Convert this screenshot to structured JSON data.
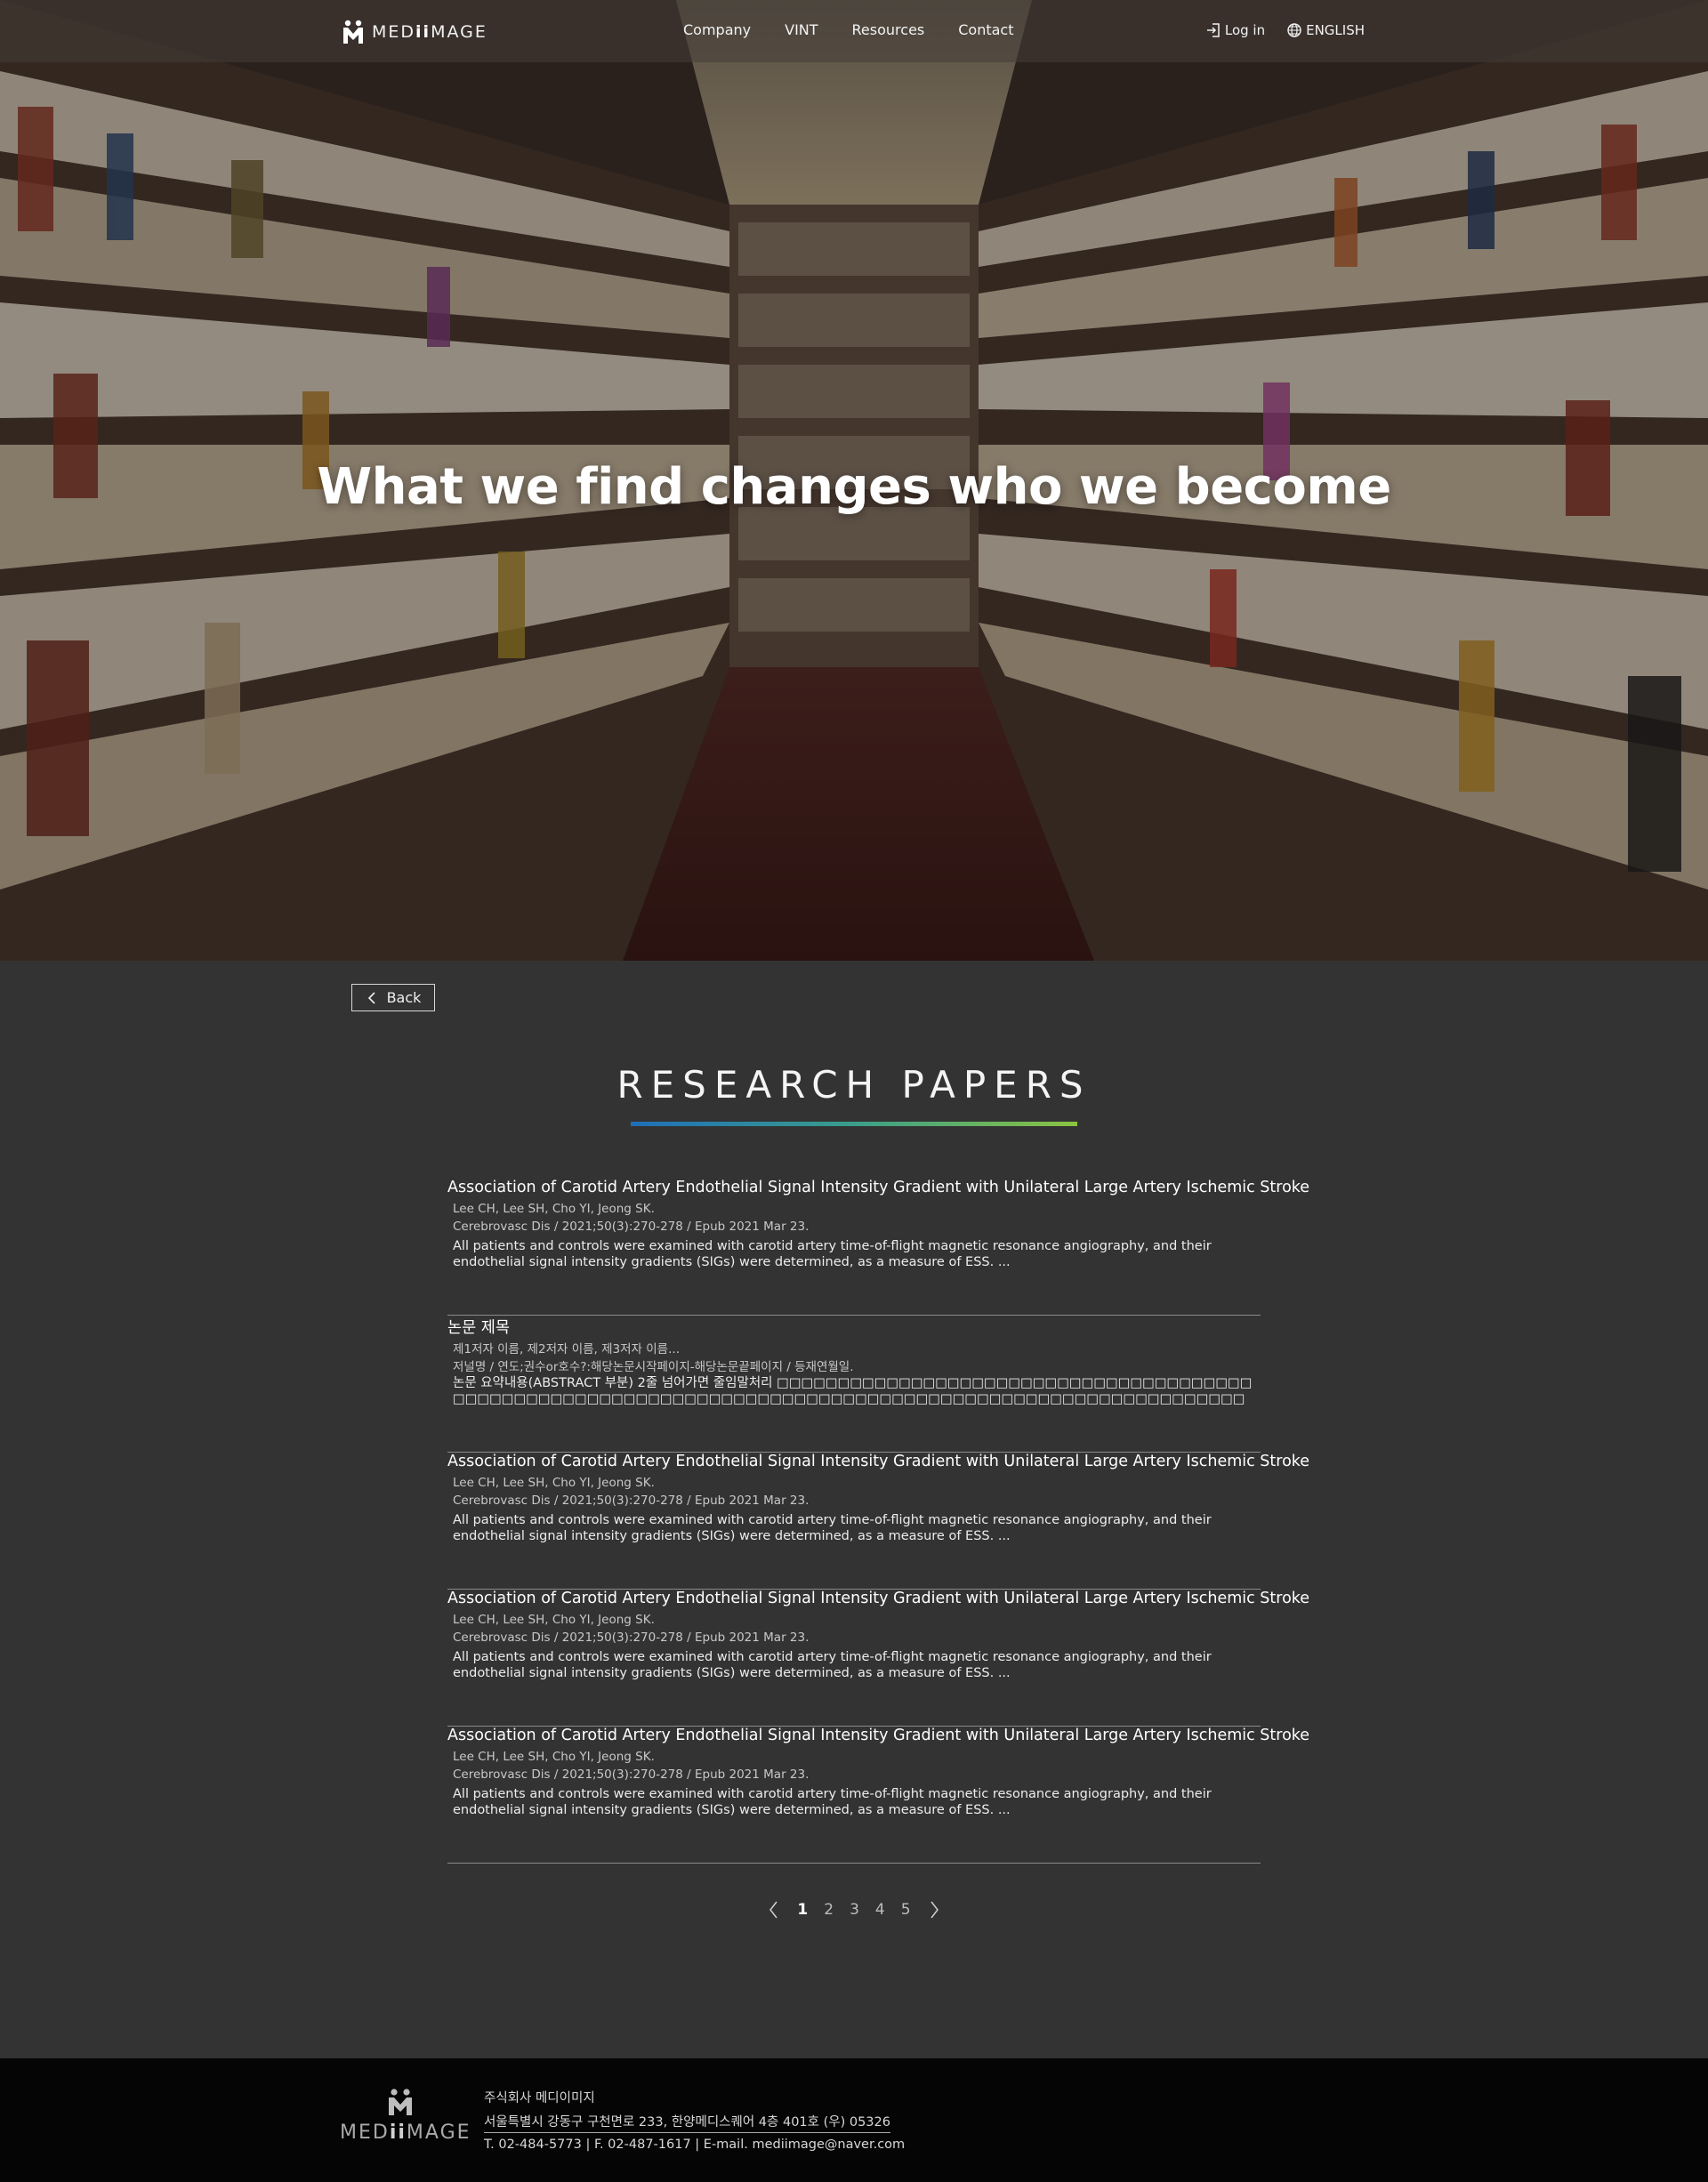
{
  "header": {
    "logo_text_pre": "MED",
    "logo_text_mid": "ii",
    "logo_text_post": "MAGE",
    "nav": [
      "Company",
      "VINT",
      "Resources",
      "Contact"
    ],
    "login_label": "Log in",
    "language_label": "ENGLISH"
  },
  "hero": {
    "title": "What we find changes who we become"
  },
  "main": {
    "back_label": "Back",
    "section_title": "RESEARCH PAPERS",
    "papers": [
      {
        "title": "Association of Carotid Artery Endothelial Signal Intensity Gradient with Unilateral Large Artery Ischemic Stroke",
        "authors": "Lee CH, Lee SH, Cho YI, Jeong SK.",
        "journal": "Cerebrovasc Dis / 2021;50(3):270-278 /  Epub 2021 Mar 23.",
        "summary": "All patients and controls were examined with carotid artery time-of-flight magnetic resonance angiography, and their endothelial signal intensity gradients (SIGs) were determined, as a measure of ESS. ..."
      },
      {
        "title": "논문 제목",
        "authors": "제1저자 이름, 제2저자 이름, 제3저자 이름...",
        "journal": "저널명 / 연도;권수or호수?:해당논문시작페이지-해당논문끝페이지 /  등재연월일.",
        "summary": "논문 요약내용(ABSTRACT 부분) 2줄 넘어가면 줄임말처리 □□□□□□□□□□□□□□□□□□□□□□□□□□□□□□□□□□□□□□□□□□□□□□□□□□□□□□□□□□□□□□□□□□□□□□□□□□□□□□□□□□□□□□□□□□□□□□□□□□□□□□□□□□□□□□□□..."
      },
      {
        "title": "Association of Carotid Artery Endothelial Signal Intensity Gradient with Unilateral Large Artery Ischemic Stroke",
        "authors": "Lee CH, Lee SH, Cho YI, Jeong SK.",
        "journal": "Cerebrovasc Dis / 2021;50(3):270-278 /  Epub 2021 Mar 23.",
        "summary": "All patients and controls were examined with carotid artery time-of-flight magnetic resonance angiography, and their endothelial signal intensity gradients (SIGs) were determined, as a measure of ESS. ..."
      },
      {
        "title": "Association of Carotid Artery Endothelial Signal Intensity Gradient with Unilateral Large Artery Ischemic Stroke",
        "authors": "Lee CH, Lee SH, Cho YI, Jeong SK.",
        "journal": "Cerebrovasc Dis / 2021;50(3):270-278 /  Epub 2021 Mar 23.",
        "summary": "All patients and controls were examined with carotid artery time-of-flight magnetic resonance angiography, and their endothelial signal intensity gradients (SIGs) were determined, as a measure of ESS. ..."
      },
      {
        "title": "Association of Carotid Artery Endothelial Signal Intensity Gradient with Unilateral Large Artery Ischemic Stroke",
        "authors": "Lee CH, Lee SH, Cho YI, Jeong SK.",
        "journal": "Cerebrovasc Dis / 2021;50(3):270-278 /  Epub 2021 Mar 23.",
        "summary": "All patients and controls were examined with carotid artery time-of-flight magnetic resonance angiography, and their endothelial signal intensity gradients (SIGs) were determined, as a measure of ESS. ..."
      }
    ],
    "pagination": {
      "pages": [
        "1",
        "2",
        "3",
        "4",
        "5"
      ],
      "current": "1"
    }
  },
  "footer": {
    "logo_text_pre": "MED",
    "logo_text_mid": "ii",
    "logo_text_post": "MAGE",
    "company": "주식회사 메디이미지",
    "address": "서울특별시 강동구 구천면로 233, 한양메디스퀘어 4층 401호 (우) 05326",
    "contact": "T. 02-484-5773  |  F. 02-487-1617  |  E-mail. mediimage@naver.com"
  },
  "colors": {
    "background": "#333333",
    "footer": "#050505",
    "accent_gradient": [
      "#1f6fb8",
      "#3a9e8a",
      "#8bc440"
    ]
  },
  "icons": [
    "logo-mark-icon",
    "login-icon",
    "globe-icon",
    "chevron-left-icon",
    "chevron-right-icon"
  ]
}
